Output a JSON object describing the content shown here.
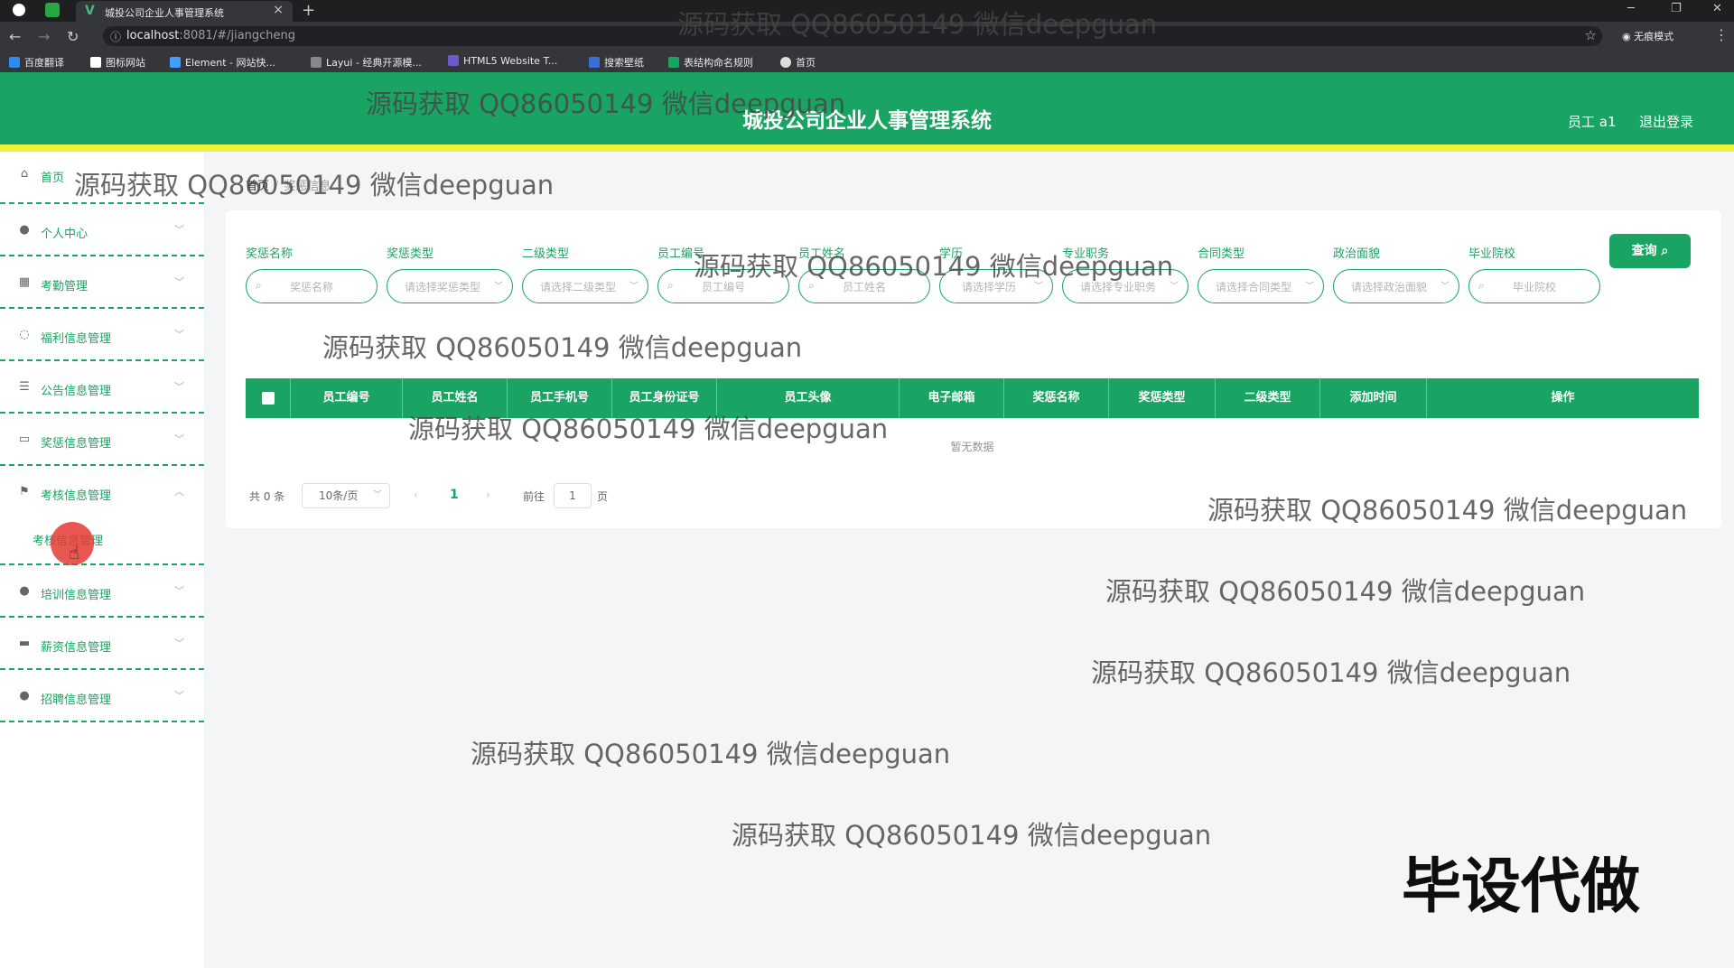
{
  "browser": {
    "tab_title": "城投公司企业人事管理系统",
    "url_host": "localhost",
    "url_path": ":8081/#/jiangcheng",
    "profile_label": "无痕模式",
    "bookmarks": [
      "百度翻译",
      "图标网站",
      "Element - 网站快...",
      "Layui - 经典开源模...",
      "HTML5 Website T...",
      "搜索壁纸",
      "表结构命名规则",
      "首页"
    ]
  },
  "header": {
    "title": "城投公司企业人事管理系统",
    "user": "员工 a1",
    "logout": "退出登录"
  },
  "sidebar": {
    "home": "首页",
    "items": [
      {
        "label": "个人中心",
        "icon": "user-icon"
      },
      {
        "label": "考勤管理",
        "icon": "grid-icon"
      },
      {
        "label": "福利信息管理",
        "icon": "bulb-icon"
      },
      {
        "label": "公告信息管理",
        "icon": "sliders-icon"
      },
      {
        "label": "奖惩信息管理",
        "icon": "card-icon"
      },
      {
        "label": "考核信息管理",
        "icon": "flag-icon"
      },
      {
        "label": "培训信息管理",
        "icon": "person-icon"
      },
      {
        "label": "薪资信息管理",
        "icon": "chat-icon"
      },
      {
        "label": "招聘信息管理",
        "icon": "location-icon"
      }
    ],
    "submenu_active": "考核信息管理"
  },
  "breadcrumb": {
    "home": "首页",
    "current": "奖惩信息"
  },
  "filters": [
    {
      "label": "奖惩名称",
      "placeholder": "奖惩名称",
      "type": "search"
    },
    {
      "label": "奖惩类型",
      "placeholder": "请选择奖惩类型",
      "type": "select"
    },
    {
      "label": "二级类型",
      "placeholder": "请选择二级类型",
      "type": "select"
    },
    {
      "label": "员工编号",
      "placeholder": "员工编号",
      "type": "search"
    },
    {
      "label": "员工姓名",
      "placeholder": "员工姓名",
      "type": "search"
    },
    {
      "label": "学历",
      "placeholder": "请选择学历",
      "type": "select"
    },
    {
      "label": "专业职务",
      "placeholder": "请选择专业职务",
      "type": "select"
    },
    {
      "label": "合同类型",
      "placeholder": "请选择合同类型",
      "type": "select"
    },
    {
      "label": "政治面貌",
      "placeholder": "请选择政治面貌",
      "type": "select"
    },
    {
      "label": "毕业院校",
      "placeholder": "毕业院校",
      "type": "search"
    }
  ],
  "query_button": "查询",
  "table": {
    "columns": [
      "员工编号",
      "员工姓名",
      "员工手机号",
      "员工身份证号",
      "员工头像",
      "电子邮箱",
      "奖惩名称",
      "奖惩类型",
      "二级类型",
      "添加时间",
      "操作"
    ],
    "empty_text": "暂无数据"
  },
  "pagination": {
    "total": "共 0 条",
    "page_size": "10条/页",
    "current_page": "1",
    "goto_label": "前往",
    "goto_value": "1",
    "page_suffix": "页"
  },
  "watermark": "源码获取 QQ86050149 微信deepguan",
  "stamp": "毕设代做",
  "colors": {
    "primary": "#19a463",
    "accent_bar": "#eef23a"
  }
}
